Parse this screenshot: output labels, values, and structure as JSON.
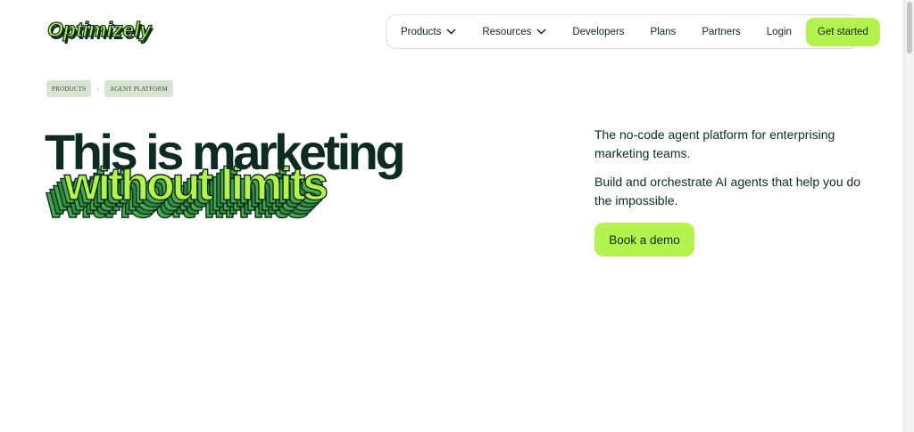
{
  "logo": {
    "text": "Optimizely"
  },
  "nav": {
    "products": "Products",
    "resources": "Resources",
    "developers": "Developers",
    "plans": "Plans",
    "partners": "Partners",
    "login": "Login",
    "get_started": "Get started"
  },
  "breadcrumb": {
    "items": [
      "PRODUCTS",
      "AGENT PLATFORM"
    ],
    "separator": "›"
  },
  "hero": {
    "line1": "This is marketing",
    "line2": "without limits",
    "intro1": "The no-code agent platform for enterprising marketing teams.",
    "intro2": "Build and orchestrate AI agents that help you do the impossible.",
    "cta": "Book a demo"
  },
  "colors": {
    "brand_green": "#b4f34d",
    "dark_green": "#0d2b1e",
    "mid_green": "#2f8b3f",
    "breadcrumb_bg": "#d8e5d0"
  },
  "icons": {
    "products_dropdown": "chevron-down-icon",
    "resources_dropdown": "chevron-down-icon"
  }
}
